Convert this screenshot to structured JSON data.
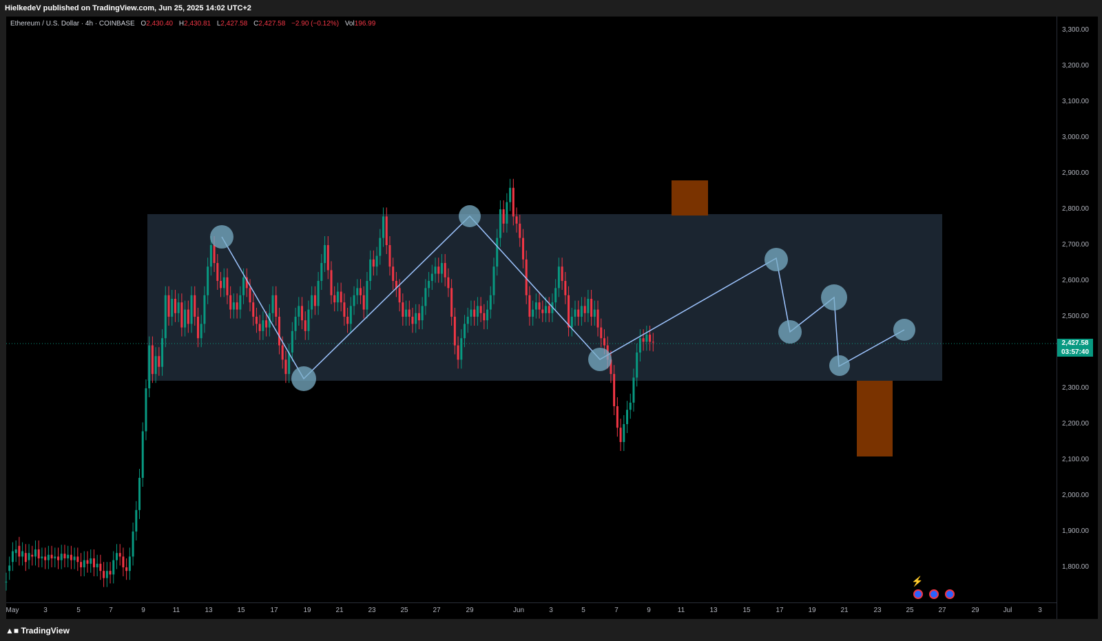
{
  "header": {
    "text": "HielkedeV published on TradingView.com, Jun 25, 2025 14:02 UTC+2"
  },
  "legend": {
    "symbol": "Ethereum / U.S. Dollar · 4h · COINBASE",
    "o_label": "O",
    "o_value": "2,430.40",
    "h_label": "H",
    "h_value": "2,430.81",
    "l_label": "L",
    "l_value": "2,427.58",
    "c_label": "C",
    "c_value": "2,427.58",
    "change": "−2.90 (−0.12%)",
    "vol_label": "Vol",
    "vol_value": "196.99"
  },
  "price_axis": [
    "3,300.00",
    "3,200.00",
    "3,100.00",
    "3,000.00",
    "2,900.00",
    "2,800.00",
    "2,700.00",
    "2,600.00",
    "2,500.00",
    "2,300.00",
    "2,200.00",
    "2,100.00",
    "2,000.00",
    "1,900.00",
    "1,800.00"
  ],
  "time_axis": [
    "May",
    "3",
    "5",
    "7",
    "9",
    "11",
    "13",
    "15",
    "17",
    "19",
    "21",
    "23",
    "25",
    "27",
    "29",
    "Jun",
    "3",
    "5",
    "7",
    "9",
    "11",
    "13",
    "15",
    "17",
    "19",
    "21",
    "23",
    "25",
    "27",
    "29",
    "Jul",
    "3"
  ],
  "current_price": {
    "price": "2,427.58",
    "countdown": "03:57:40"
  },
  "footer": {
    "logo": "TradingView"
  },
  "colors": {
    "up": "#089981",
    "down": "#f23645",
    "pattern_line": "#9ec5ff",
    "zone": "#1b2530",
    "orange_box": "#7a3300"
  },
  "chart_data": {
    "type": "candlestick",
    "title": "Ethereum / U.S. Dollar · 4h · COINBASE",
    "ylim": [
      1700,
      3350
    ],
    "x_start": "May 1",
    "x_end": "Jul 4",
    "candles": [
      [
        0,
        1760,
        1760
      ],
      [
        0.2,
        1790,
        1805
      ],
      [
        0.4,
        1815,
        1845
      ],
      [
        0.6,
        1840,
        1850
      ],
      [
        0.8,
        1860,
        1830
      ],
      [
        1.0,
        1830,
        1845
      ],
      [
        1.2,
        1840,
        1815
      ],
      [
        1.4,
        1820,
        1840
      ],
      [
        1.6,
        1835,
        1830
      ],
      [
        1.8,
        1830,
        1850
      ],
      [
        2.0,
        1850,
        1825
      ],
      [
        2.2,
        1825,
        1830
      ],
      [
        2.4,
        1830,
        1820
      ],
      [
        2.6,
        1820,
        1835
      ],
      [
        2.8,
        1835,
        1825
      ],
      [
        3.0,
        1825,
        1830
      ],
      [
        3.2,
        1830,
        1820
      ],
      [
        3.4,
        1820,
        1838
      ],
      [
        3.6,
        1838,
        1825
      ],
      [
        3.8,
        1825,
        1835
      ],
      [
        4.0,
        1835,
        1820
      ],
      [
        4.2,
        1820,
        1830
      ],
      [
        4.4,
        1830,
        1815
      ],
      [
        4.6,
        1815,
        1800
      ],
      [
        4.8,
        1800,
        1820
      ],
      [
        5.0,
        1820,
        1810
      ],
      [
        5.2,
        1810,
        1825
      ],
      [
        5.4,
        1825,
        1800
      ],
      [
        5.6,
        1800,
        1810
      ],
      [
        5.8,
        1810,
        1790
      ],
      [
        6.0,
        1790,
        1770
      ],
      [
        6.2,
        1770,
        1790
      ],
      [
        6.4,
        1790,
        1780
      ],
      [
        6.6,
        1780,
        1820
      ],
      [
        6.8,
        1820,
        1840
      ],
      [
        7.0,
        1840,
        1830
      ],
      [
        7.2,
        1830,
        1800
      ],
      [
        7.4,
        1800,
        1790
      ],
      [
        7.6,
        1790,
        1830
      ],
      [
        7.8,
        1830,
        1900
      ],
      [
        8.0,
        1900,
        1960
      ],
      [
        8.2,
        1960,
        2050
      ],
      [
        8.4,
        2050,
        2180
      ],
      [
        8.6,
        2180,
        2300
      ],
      [
        8.8,
        2300,
        2420
      ],
      [
        9.0,
        2420,
        2340
      ],
      [
        9.2,
        2340,
        2390
      ],
      [
        9.4,
        2390,
        2360
      ],
      [
        9.6,
        2360,
        2440
      ],
      [
        9.8,
        2440,
        2560
      ],
      [
        10.0,
        2560,
        2500
      ],
      [
        10.2,
        2500,
        2550
      ],
      [
        10.4,
        2550,
        2510
      ],
      [
        10.6,
        2510,
        2540
      ],
      [
        10.8,
        2540,
        2470
      ],
      [
        11.0,
        2470,
        2520
      ],
      [
        11.2,
        2520,
        2480
      ],
      [
        11.4,
        2480,
        2560
      ],
      [
        11.6,
        2560,
        2500
      ],
      [
        11.8,
        2500,
        2440
      ],
      [
        12.0,
        2440,
        2480
      ],
      [
        12.2,
        2480,
        2560
      ],
      [
        12.4,
        2560,
        2640
      ],
      [
        12.6,
        2640,
        2700
      ],
      [
        12.8,
        2700,
        2650
      ],
      [
        13.0,
        2650,
        2600
      ],
      [
        13.2,
        2600,
        2580
      ],
      [
        13.4,
        2580,
        2610
      ],
      [
        13.6,
        2610,
        2560
      ],
      [
        13.8,
        2560,
        2520
      ],
      [
        14.0,
        2520,
        2540
      ],
      [
        14.2,
        2540,
        2520
      ],
      [
        14.4,
        2520,
        2560
      ],
      [
        14.6,
        2560,
        2610
      ],
      [
        14.8,
        2610,
        2580
      ],
      [
        15.0,
        2580,
        2540
      ],
      [
        15.2,
        2540,
        2500
      ],
      [
        15.4,
        2500,
        2480
      ],
      [
        15.6,
        2480,
        2460
      ],
      [
        15.8,
        2460,
        2490
      ],
      [
        16.0,
        2490,
        2470
      ],
      [
        16.2,
        2470,
        2510
      ],
      [
        16.4,
        2510,
        2560
      ],
      [
        16.6,
        2560,
        2500
      ],
      [
        16.8,
        2500,
        2420
      ],
      [
        17.0,
        2420,
        2380
      ],
      [
        17.2,
        2380,
        2340
      ],
      [
        17.4,
        2340,
        2400
      ],
      [
        17.6,
        2400,
        2460
      ],
      [
        17.8,
        2460,
        2500
      ],
      [
        18.0,
        2500,
        2530
      ],
      [
        18.2,
        2530,
        2490
      ],
      [
        18.4,
        2490,
        2460
      ],
      [
        18.6,
        2460,
        2520
      ],
      [
        18.8,
        2520,
        2560
      ],
      [
        19.0,
        2560,
        2530
      ],
      [
        19.2,
        2530,
        2600
      ],
      [
        19.4,
        2600,
        2650
      ],
      [
        19.6,
        2650,
        2700
      ],
      [
        19.8,
        2700,
        2630
      ],
      [
        20.0,
        2630,
        2560
      ],
      [
        20.2,
        2560,
        2540
      ],
      [
        20.4,
        2540,
        2570
      ],
      [
        20.6,
        2570,
        2540
      ],
      [
        20.8,
        2540,
        2500
      ],
      [
        21.0,
        2500,
        2480
      ],
      [
        21.2,
        2480,
        2530
      ],
      [
        21.4,
        2530,
        2560
      ],
      [
        21.6,
        2560,
        2580
      ],
      [
        21.8,
        2580,
        2560
      ],
      [
        22.0,
        2560,
        2520
      ],
      [
        22.2,
        2520,
        2600
      ],
      [
        22.4,
        2600,
        2660
      ],
      [
        22.6,
        2660,
        2640
      ],
      [
        22.8,
        2640,
        2670
      ],
      [
        23.0,
        2670,
        2720
      ],
      [
        23.2,
        2720,
        2780
      ],
      [
        23.4,
        2780,
        2700
      ],
      [
        23.6,
        2700,
        2640
      ],
      [
        23.8,
        2640,
        2600
      ],
      [
        24.0,
        2600,
        2580
      ],
      [
        24.2,
        2580,
        2540
      ],
      [
        24.4,
        2540,
        2500
      ],
      [
        24.6,
        2500,
        2520
      ],
      [
        24.8,
        2520,
        2500
      ],
      [
        25.0,
        2500,
        2480
      ],
      [
        25.2,
        2480,
        2510
      ],
      [
        25.4,
        2510,
        2490
      ],
      [
        25.6,
        2490,
        2530
      ],
      [
        25.8,
        2530,
        2580
      ],
      [
        26.0,
        2580,
        2600
      ],
      [
        26.2,
        2600,
        2620
      ],
      [
        26.4,
        2620,
        2640
      ],
      [
        26.6,
        2640,
        2620
      ],
      [
        26.8,
        2620,
        2650
      ],
      [
        27.0,
        2650,
        2610
      ],
      [
        27.2,
        2610,
        2580
      ],
      [
        27.4,
        2580,
        2500
      ],
      [
        27.6,
        2500,
        2420
      ],
      [
        27.8,
        2420,
        2380
      ],
      [
        28.0,
        2380,
        2440
      ],
      [
        28.2,
        2440,
        2480
      ],
      [
        28.4,
        2480,
        2500
      ],
      [
        28.6,
        2500,
        2520
      ],
      [
        28.8,
        2520,
        2500
      ],
      [
        29.0,
        2500,
        2530
      ],
      [
        29.2,
        2530,
        2510
      ],
      [
        29.4,
        2510,
        2490
      ],
      [
        29.6,
        2490,
        2520
      ],
      [
        29.8,
        2520,
        2560
      ],
      [
        30.0,
        2560,
        2640
      ],
      [
        30.2,
        2640,
        2720
      ],
      [
        30.4,
        2720,
        2800
      ],
      [
        30.6,
        2800,
        2760
      ],
      [
        30.8,
        2760,
        2820
      ],
      [
        31.0,
        2820,
        2860
      ],
      [
        31.2,
        2860,
        2780
      ],
      [
        31.4,
        2780,
        2760
      ],
      [
        31.6,
        2760,
        2720
      ],
      [
        31.8,
        2720,
        2660
      ],
      [
        32.0,
        2660,
        2560
      ],
      [
        32.2,
        2560,
        2500
      ],
      [
        32.4,
        2500,
        2520
      ],
      [
        32.6,
        2520,
        2540
      ],
      [
        32.8,
        2540,
        2520
      ],
      [
        33.0,
        2520,
        2510
      ],
      [
        33.2,
        2510,
        2530
      ],
      [
        33.4,
        2530,
        2510
      ],
      [
        33.6,
        2510,
        2540
      ],
      [
        33.8,
        2540,
        2580
      ],
      [
        34.0,
        2580,
        2640
      ],
      [
        34.2,
        2640,
        2600
      ],
      [
        34.4,
        2600,
        2560
      ],
      [
        34.6,
        2560,
        2470
      ],
      [
        34.8,
        2470,
        2500
      ],
      [
        35.0,
        2500,
        2520
      ],
      [
        35.2,
        2520,
        2500
      ],
      [
        35.4,
        2500,
        2530
      ],
      [
        35.6,
        2530,
        2510
      ],
      [
        35.8,
        2510,
        2550
      ],
      [
        36.0,
        2550,
        2500
      ],
      [
        36.2,
        2500,
        2520
      ],
      [
        36.4,
        2520,
        2470
      ],
      [
        36.6,
        2470,
        2440
      ],
      [
        36.8,
        2440,
        2420
      ],
      [
        37.0,
        2420,
        2380
      ],
      [
        37.2,
        2380,
        2340
      ],
      [
        37.4,
        2340,
        2250
      ],
      [
        37.6,
        2250,
        2190
      ],
      [
        37.8,
        2190,
        2150
      ],
      [
        38.0,
        2150,
        2200
      ],
      [
        38.2,
        2200,
        2240
      ],
      [
        38.4,
        2240,
        2260
      ],
      [
        38.6,
        2260,
        2330
      ],
      [
        38.8,
        2330,
        2400
      ],
      [
        39.0,
        2400,
        2440
      ],
      [
        39.2,
        2440,
        2430
      ],
      [
        39.4,
        2430,
        2450
      ],
      [
        39.6,
        2450,
        2430
      ],
      [
        39.8,
        2430,
        2428
      ]
    ]
  }
}
